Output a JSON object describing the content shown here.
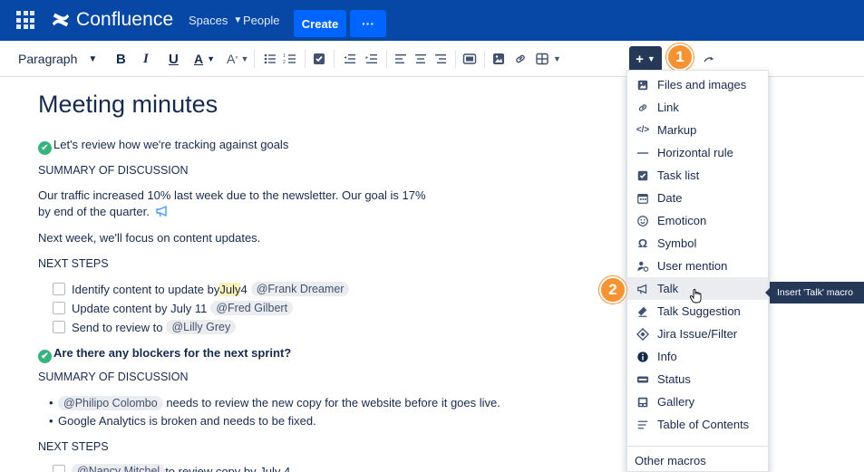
{
  "nav": {
    "app_name": "Confluence",
    "spaces_label": "Spaces",
    "people_label": "People",
    "create_label": "Create",
    "more_label": "···"
  },
  "toolbar": {
    "paragraph_label": "Paragraph",
    "insert_label": "+",
    "badge_1": "1",
    "badge_2": "2"
  },
  "page": {
    "title": "Meeting minutes",
    "section1_heading": "Let's review how we're tracking against goals",
    "summary_label_1": "SUMMARY OF DISCUSSION",
    "traffic_line_1": "Our traffic increased 10% last week due to the newsletter. Our goal is 17%",
    "traffic_line_2": "by end of the quarter.",
    "next_week": "Next week, we'll focus on content updates.",
    "next_steps_1": "NEXT STEPS",
    "tasks": [
      {
        "pre": "Identify content to update by ",
        "highlight": "July",
        "post": " 4",
        "mention": "@Frank Dreamer"
      },
      {
        "pre": "Update content by July 11",
        "highlight": "",
        "post": "",
        "mention": "@Fred Gilbert"
      },
      {
        "pre": "Send to review to",
        "highlight": "",
        "post": "",
        "mention": "@Lilly Grey"
      }
    ],
    "section2_heading": "Are there any blockers for the next sprint?",
    "summary_label_2": "SUMMARY OF DISCUSSION",
    "bullets": [
      {
        "mention": "@Philipo Colombo",
        "text": " needs to review the new copy for the website before it goes live."
      },
      {
        "mention": "",
        "text": "Google Analytics is broken and needs to be fixed."
      }
    ],
    "next_steps_2": "NEXT STEPS",
    "last_task": {
      "mention": "@Nancy Mitchel",
      "text": " to review copy by July 4"
    }
  },
  "menu": {
    "items": [
      {
        "label": "Files and images",
        "icon": "image-icon"
      },
      {
        "label": "Link",
        "icon": "link-icon"
      },
      {
        "label": "Markup",
        "icon": "code-icon"
      },
      {
        "label": "Horizontal rule",
        "icon": "horizontal-rule-icon"
      },
      {
        "label": "Task list",
        "icon": "checkbox-icon"
      },
      {
        "label": "Date",
        "icon": "calendar-icon"
      },
      {
        "label": "Emoticon",
        "icon": "smiley-icon"
      },
      {
        "label": "Symbol",
        "icon": "omega-icon"
      },
      {
        "label": "User mention",
        "icon": "user-mention-icon"
      },
      {
        "label": "Talk",
        "icon": "megaphone-icon"
      },
      {
        "label": "Talk Suggestion",
        "icon": "talk-suggestion-icon"
      },
      {
        "label": "Jira Issue/Filter",
        "icon": "jira-icon"
      },
      {
        "label": "Info",
        "icon": "info-icon"
      },
      {
        "label": "Status",
        "icon": "status-icon"
      },
      {
        "label": "Gallery",
        "icon": "gallery-icon"
      },
      {
        "label": "Table of Contents",
        "icon": "toc-icon"
      }
    ],
    "other_macros": "Other macros",
    "tooltip": "Insert 'Talk' macro"
  },
  "colors": {
    "nav_bg": "#0747a6",
    "create_bg": "#0065ff",
    "badge": "#f79232",
    "success": "#36b37e"
  }
}
